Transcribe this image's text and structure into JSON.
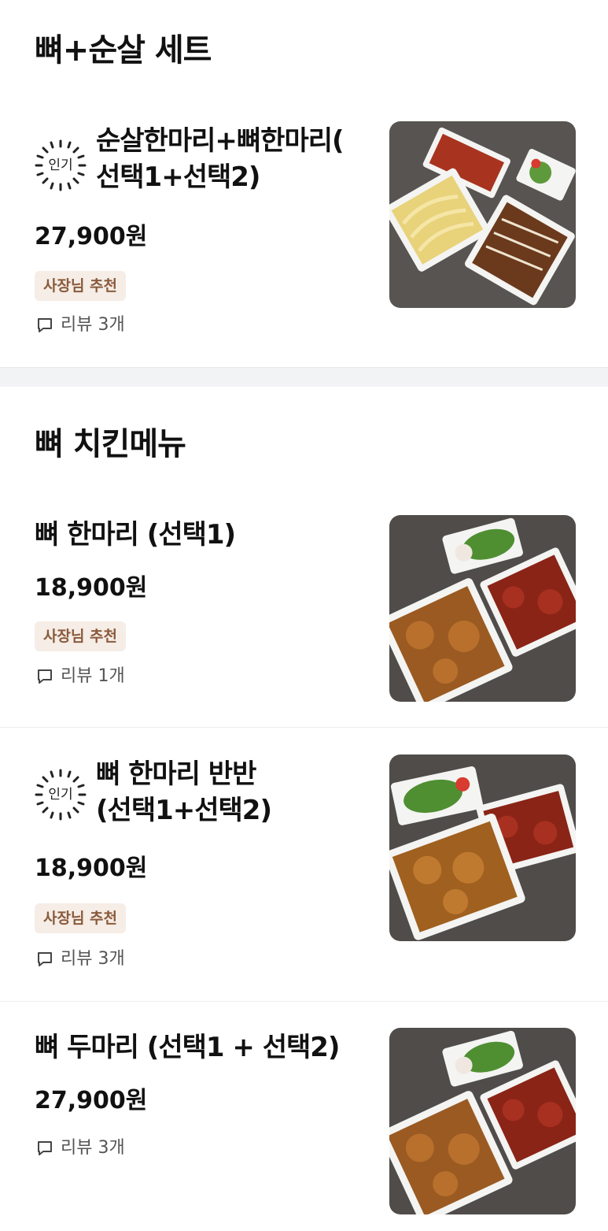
{
  "sections": [
    {
      "title": "뼈+순살 세트",
      "items": [
        {
          "title": "순살한마리+뼈한마리(\n선택1+선택2)",
          "price": "27,900원",
          "popular_badge": "인기",
          "owner_badge": "사장님 추천",
          "reviews": "리뷰 3개",
          "image_icon": "chicken-set-photo"
        }
      ]
    },
    {
      "title": "뼈 치킨메뉴",
      "items": [
        {
          "title": "뼈 한마리 (선택1)",
          "price": "18,900원",
          "owner_badge": "사장님 추천",
          "reviews": "리뷰 1개",
          "image_icon": "chicken-photo"
        },
        {
          "title": "뼈 한마리 반반\n(선택1+선택2)",
          "price": "18,900원",
          "popular_badge": "인기",
          "owner_badge": "사장님 추천",
          "reviews": "리뷰 3개",
          "image_icon": "chicken-half-half-photo"
        },
        {
          "title": "뼈 두마리 (선택1 + 선택2)",
          "price": "27,900원",
          "reviews": "리뷰 3개",
          "image_icon": "chicken-two-photo"
        }
      ]
    }
  ],
  "colors": {
    "owner_badge_bg": "#f5ede6",
    "owner_badge_text": "#8a5a3c",
    "section_band": "#f2f3f5"
  }
}
